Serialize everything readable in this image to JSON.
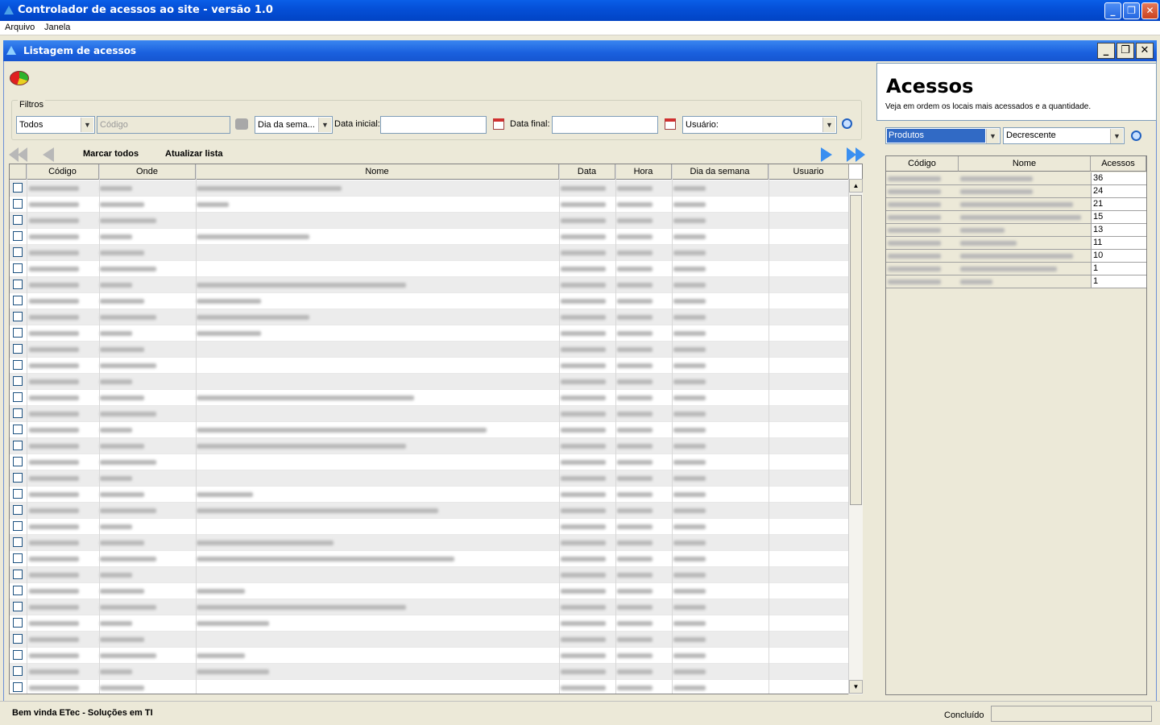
{
  "window": {
    "title": "Controlador de acessos ao site - versão 1.0"
  },
  "menu": [
    "Arquivo",
    "Janela"
  ],
  "inner_window": {
    "title": "Listagem de acessos"
  },
  "filters": {
    "legend": "Filtros",
    "onde_value": "Todos",
    "codigo_placeholder": "Código",
    "dia_semana_value": "Dia da sema...",
    "data_inicial_label": "Data inicial:",
    "data_final_label": "Data final:",
    "usuario_value": "Usuário:"
  },
  "toolbar": {
    "marcar_todos": "Marcar todos",
    "atualizar_lista": "Atualizar lista"
  },
  "table": {
    "columns": [
      "Código",
      "Onde",
      "Nome",
      "Data",
      "Hora",
      "Dia da semana",
      "Usuario"
    ]
  },
  "side": {
    "title": "Acessos",
    "subtitle": "Veja em ordem os locais mais acessados e a quantidade.",
    "tipo_value": "Produtos",
    "ordem_value": "Decrescente",
    "columns": [
      "Código",
      "Nome",
      "Acessos"
    ],
    "acessos": [
      "36",
      "24",
      "21",
      "15",
      "13",
      "11",
      "10",
      "1",
      "1"
    ]
  },
  "status": {
    "left": "Bem vinda ETec - Soluções em TI",
    "right": "Concluído"
  }
}
